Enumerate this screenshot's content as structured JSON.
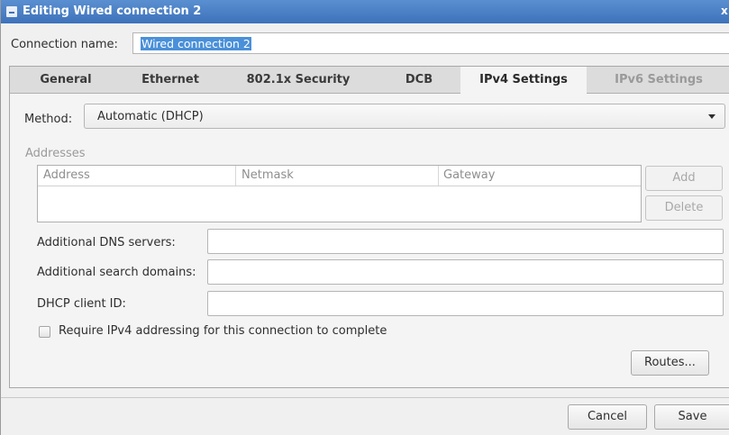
{
  "window": {
    "title": "Editing Wired connection 2",
    "close_glyph": "x"
  },
  "connection": {
    "label": "Connection name:",
    "value": "Wired connection 2"
  },
  "tabs": [
    {
      "label": "General",
      "state": "normal"
    },
    {
      "label": "Ethernet",
      "state": "normal"
    },
    {
      "label": "802.1x Security",
      "state": "normal"
    },
    {
      "label": "DCB",
      "state": "normal"
    },
    {
      "label": "IPv4 Settings",
      "state": "active"
    },
    {
      "label": "IPv6 Settings",
      "state": "disabled"
    }
  ],
  "method": {
    "label": "Method:",
    "value": "Automatic (DHCP)"
  },
  "addresses": {
    "heading": "Addresses",
    "columns": [
      "Address",
      "Netmask",
      "Gateway"
    ],
    "add_label": "Add",
    "delete_label": "Delete"
  },
  "fields": {
    "dns_label": "Additional DNS servers:",
    "dns_value": "",
    "search_label": "Additional search domains:",
    "search_value": "",
    "dhcp_label": "DHCP client ID:",
    "dhcp_value": ""
  },
  "require_ipv4": {
    "label": "Require IPv4 addressing for this connection to complete",
    "checked": false
  },
  "buttons": {
    "routes": "Routes...",
    "cancel": "Cancel",
    "save": "Save"
  }
}
